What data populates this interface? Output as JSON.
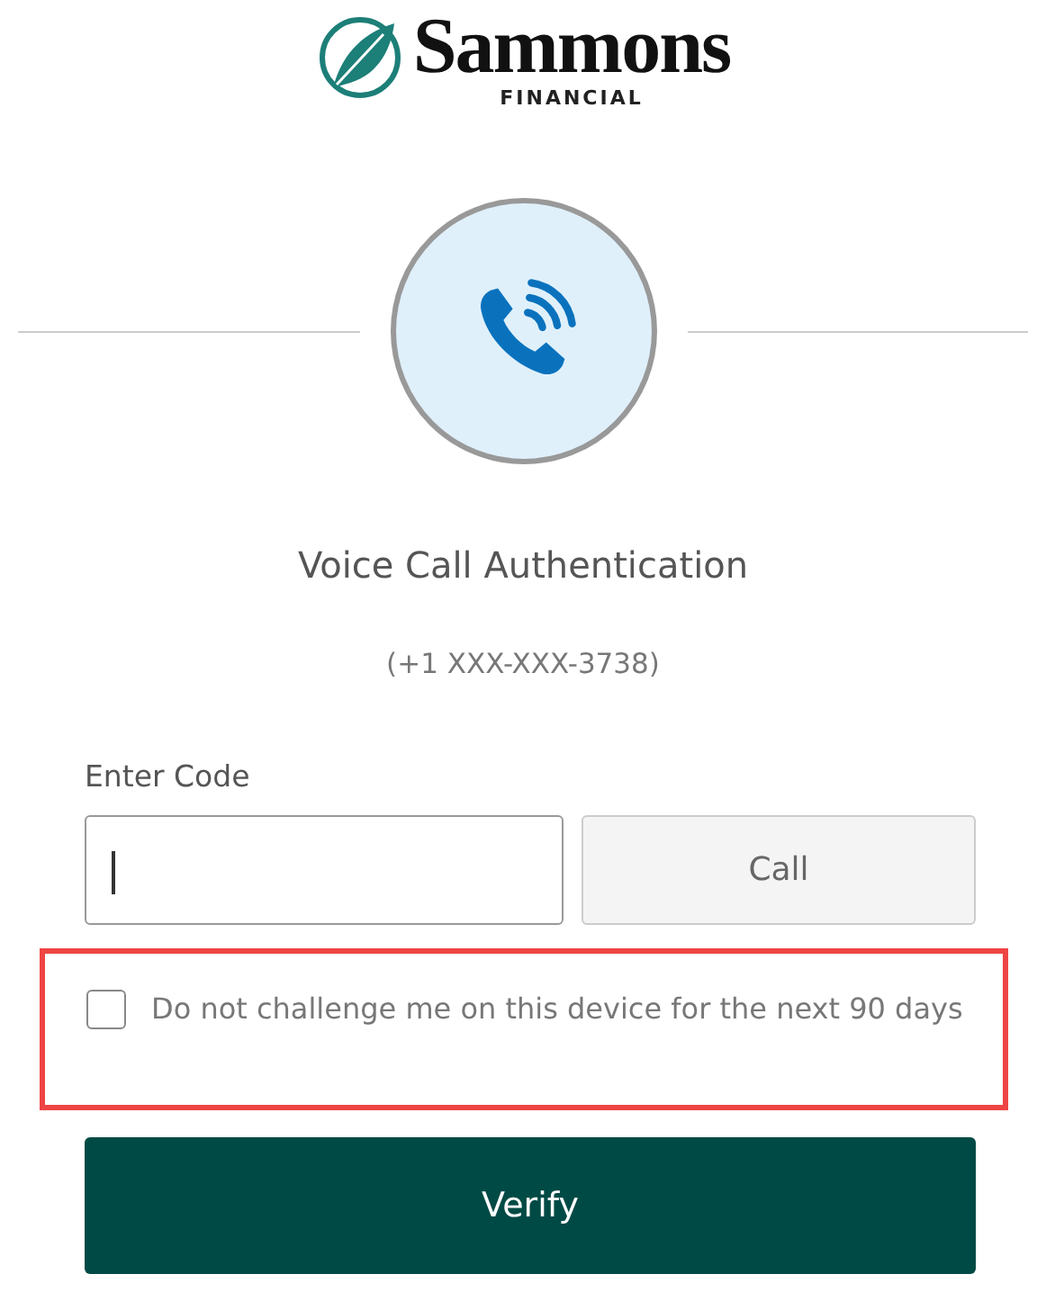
{
  "logo": {
    "name": "Sammons",
    "subtitle": "FINANCIAL"
  },
  "title": "Voice Call Authentication",
  "phone": "(+1 XXX-XXX-3738)",
  "code_field": {
    "label": "Enter Code",
    "focused": true
  },
  "call_button": "Call",
  "remember": {
    "label": "Do not challenge me on this device for the next 90 days",
    "checked": false,
    "highlighted": true
  },
  "verify_button": "Verify"
}
